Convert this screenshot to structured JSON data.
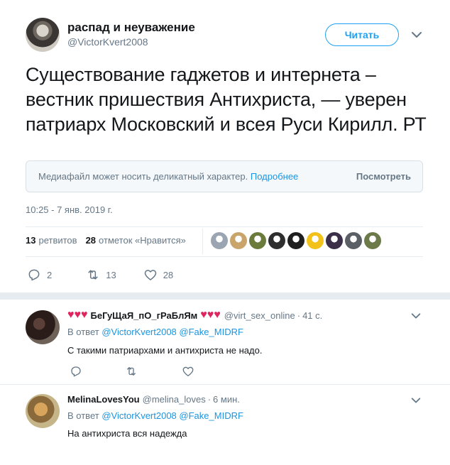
{
  "tweet": {
    "author_name": "распад и неуважение",
    "author_handle": "@VictorKvert2008",
    "follow_label": "Читать",
    "text": "Существование гаджетов и интернета – вестник пришествия Антихриста, — уверен патриарх Московский и всея Руси Кирилл. РТ",
    "sensitive_notice": "Медиафайл может носить деликатный характер.",
    "sensitive_link": "Подробнее",
    "sensitive_button": "Посмотреть",
    "timestamp": "10:25 - 7 янв. 2019 г.",
    "retweets_count": "13",
    "retweets_label": "ретвитов",
    "likes_count": "28",
    "likes_label": "отметок «Нравится»",
    "reply_count": "2",
    "retweet_count_action": "13",
    "like_count_action": "28"
  },
  "likers": [
    {
      "color": "#9aa5b1"
    },
    {
      "color": "#c9a46b"
    },
    {
      "color": "#6a7b3c"
    },
    {
      "color": "#2e2e2e"
    },
    {
      "color": "#1f1f1f"
    },
    {
      "color": "#f2c21b"
    },
    {
      "color": "#3b2f4a"
    },
    {
      "color": "#5b5f66"
    },
    {
      "color": "#6c7a4a"
    }
  ],
  "replies": [
    {
      "name_hearts_left": "♥♥♥",
      "name": "БеГуЩаЯ_пО_гРаБлЯм",
      "name_hearts_right": "♥♥♥",
      "handle": "@virt_sex_online",
      "time": "41 с.",
      "reply_to_label": "В ответ",
      "mention1": "@VictorKvert2008",
      "mention2": "@Fake_MIDRF",
      "text": "С такими патриархами и антихриста не надо."
    },
    {
      "name": "MelinaLovesYou",
      "handle": "@melina_loves",
      "time": "6 мин.",
      "reply_to_label": "В ответ",
      "mention1": "@VictorKvert2008",
      "mention2": "@Fake_MIDRF",
      "text": "На антихриста вся надежда"
    }
  ],
  "colors": {
    "accent": "#1da1f2",
    "link": "#1b95e0",
    "muted": "#657786",
    "heart": "#e0245e"
  }
}
